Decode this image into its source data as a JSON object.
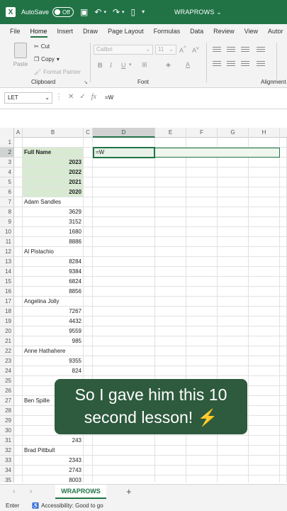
{
  "titlebar": {
    "autosave_label": "AutoSave",
    "autosave_state": "Off",
    "title": "WRAPROWS"
  },
  "ribbon_tabs": [
    "File",
    "Home",
    "Insert",
    "Draw",
    "Page Layout",
    "Formulas",
    "Data",
    "Review",
    "View",
    "Autor"
  ],
  "active_tab": "Home",
  "clipboard": {
    "paste": "Paste",
    "cut": "Cut",
    "copy": "Copy",
    "format_painter": "Format Painter",
    "group": "Clipboard"
  },
  "font": {
    "name": "Calibri",
    "size": "11",
    "group": "Font"
  },
  "alignment": {
    "group": "Alignment"
  },
  "formula_bar": {
    "name_box": "LET",
    "formula": "=W"
  },
  "columns": [
    "A",
    "B",
    "C",
    "D",
    "E",
    "F",
    "G",
    "H"
  ],
  "rows": [
    {
      "n": "1",
      "b": ""
    },
    {
      "n": "2",
      "b": "Full Name",
      "d": "=W"
    },
    {
      "n": "3",
      "b": "2023"
    },
    {
      "n": "4",
      "b": "2022"
    },
    {
      "n": "5",
      "b": "2021"
    },
    {
      "n": "6",
      "b": "2020"
    },
    {
      "n": "7",
      "b": "Adam Sandles"
    },
    {
      "n": "8",
      "b": "3629"
    },
    {
      "n": "9",
      "b": "3152"
    },
    {
      "n": "10",
      "b": "1680"
    },
    {
      "n": "11",
      "b": "8886"
    },
    {
      "n": "12",
      "b": "Al Pistachio"
    },
    {
      "n": "13",
      "b": "8284"
    },
    {
      "n": "14",
      "b": "9384"
    },
    {
      "n": "15",
      "b": "6824"
    },
    {
      "n": "16",
      "b": "8856"
    },
    {
      "n": "17",
      "b": "Angelina Jolly"
    },
    {
      "n": "18",
      "b": "7267"
    },
    {
      "n": "19",
      "b": "4432"
    },
    {
      "n": "20",
      "b": "9559"
    },
    {
      "n": "21",
      "b": "985"
    },
    {
      "n": "22",
      "b": "Anne Hathahere"
    },
    {
      "n": "23",
      "b": "9355"
    },
    {
      "n": "24",
      "b": "824"
    },
    {
      "n": "25",
      "b": ""
    },
    {
      "n": "26",
      "b": ""
    },
    {
      "n": "27",
      "b": "Ben Spille"
    },
    {
      "n": "28",
      "b": ""
    },
    {
      "n": "29",
      "b": ""
    },
    {
      "n": "30",
      "b": ""
    },
    {
      "n": "31",
      "b": "243"
    },
    {
      "n": "32",
      "b": "Brad Pittbull"
    },
    {
      "n": "33",
      "b": "2343"
    },
    {
      "n": "34",
      "b": "2743"
    },
    {
      "n": "35",
      "b": "8003"
    }
  ],
  "caption": "So I gave him this 10 second lesson! ⚡",
  "sheet_tab": "WRAPROWS",
  "status": {
    "mode": "Enter",
    "accessibility": "Accessibility: Good to go"
  },
  "colors": {
    "brand": "#217346",
    "header_fill": "#d9ead3",
    "caption_bg": "#2e5a3d"
  }
}
